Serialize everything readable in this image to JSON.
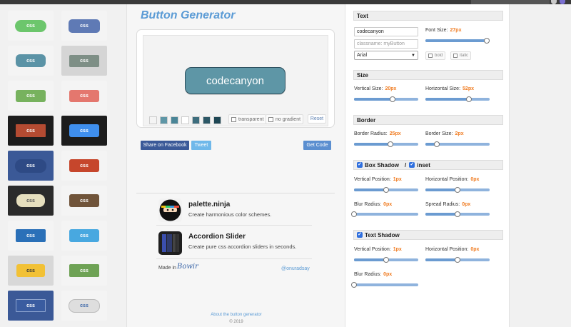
{
  "app": {
    "title": "Button Generator"
  },
  "preview": {
    "button_text": "codecanyon",
    "transparent_label": "transparent",
    "no_gradient_label": "no gradient",
    "reset_label": "Reset",
    "swatches": [
      "#f4f4f4",
      "#5e96a6",
      "#4a8597",
      "#ffffff",
      "#3d6d7d",
      "#2c5766",
      "#1e4654"
    ]
  },
  "actions": {
    "share_label": "Share on Facebook",
    "tweet_label": "Tweet",
    "get_code_label": "Get Code"
  },
  "promos": [
    {
      "title": "palette.ninja",
      "desc": "Create harmonious color schemes."
    },
    {
      "title": "Accordion Slider",
      "desc": "Create pure css accordion sliders in seconds."
    }
  ],
  "made_in": {
    "label": "Made in",
    "sig": "Bowir",
    "handle": "@onuradsay"
  },
  "footer": {
    "about": "About the button generator",
    "copyright": "© 2019"
  },
  "text_section": {
    "title": "Text",
    "text_value": "codecanyon",
    "classname_placeholder": "classname: myButton",
    "font_size_label": "Font Size:",
    "font_size_value": "27px",
    "font_size_level": 0.95,
    "font_family": "Arial",
    "bold_label": "bold",
    "italic_label": "italic"
  },
  "size_section": {
    "title": "Size",
    "vertical_label": "Vertical Size:",
    "vertical_value": "20px",
    "vertical_level": 0.6,
    "horizontal_label": "Horizontal Size:",
    "horizontal_value": "52px",
    "horizontal_level": 0.68
  },
  "border_section": {
    "title": "Border",
    "radius_label": "Border Radius:",
    "radius_value": "25px",
    "radius_level": 0.57,
    "size_label": "Border Size:",
    "size_value": "2px",
    "size_level": 0.18
  },
  "box_shadow_section": {
    "title": "Box Shadow",
    "separator": "/",
    "inset_label": "inset",
    "vpos_label": "Vertical Position:",
    "vpos_value": "1px",
    "vpos_level": 0.5,
    "hpos_label": "Horizontal Position:",
    "hpos_value": "0px",
    "hpos_level": 0.5,
    "blur_label": "Blur Radius:",
    "blur_value": "0px",
    "blur_level": 0.0,
    "spread_label": "Spread Radius:",
    "spread_value": "0px",
    "spread_level": 0.5
  },
  "text_shadow_section": {
    "title": "Text Shadow",
    "vpos_label": "Vertical Position:",
    "vpos_value": "1px",
    "vpos_level": 0.5,
    "hpos_label": "Horizontal Position:",
    "hpos_value": "0px",
    "hpos_level": 0.5,
    "blur_label": "Blur Radius:",
    "blur_value": "0px",
    "blur_level": 0.0
  },
  "presets": [
    {
      "label": "css",
      "bg": "#f4f4f4",
      "btn": "#6cc66c",
      "fg": "#ffffff"
    },
    {
      "label": "css",
      "bg": "#f4f4f4",
      "btn": "#5f7ab5",
      "fg": "#ffffff"
    },
    {
      "label": "css",
      "bg": "#f4f4f4",
      "btn": "#5b93a6",
      "fg": "#ffffff"
    },
    {
      "label": "css",
      "bg": "#d5d5d5",
      "btn": "#7e8f86",
      "fg": "#ffffff"
    },
    {
      "label": "css",
      "bg": "#f4f4f4",
      "btn": "#77b25e",
      "fg": "#ffffff"
    },
    {
      "label": "css",
      "bg": "#f4f4f4",
      "btn": "#e4776e",
      "fg": "#ffffff"
    },
    {
      "label": "css",
      "bg": "#1c1c1c",
      "btn": "#b44b32",
      "fg": "#ffffff"
    },
    {
      "label": "css",
      "bg": "#1c1c1c",
      "btn": "#3f8fee",
      "fg": "#ffffff"
    },
    {
      "label": "css",
      "bg": "#3b5997",
      "btn": "#2e4a85",
      "fg": "#ffffff"
    },
    {
      "label": "css",
      "bg": "#f4f4f4",
      "btn": "#c6462c",
      "fg": "#ffffff"
    },
    {
      "label": "css",
      "bg": "#2b2b2b",
      "btn": "#e6dfbe",
      "fg": "#555555"
    },
    {
      "label": "css",
      "bg": "#f4f4f4",
      "btn": "#70543a",
      "fg": "#ffffff"
    },
    {
      "label": "css",
      "bg": "#f4f4f4",
      "btn": "#2a70b8",
      "fg": "#ffffff"
    },
    {
      "label": "css",
      "bg": "#f4f4f4",
      "btn": "#48a8e0",
      "fg": "#ffffff"
    },
    {
      "label": "css",
      "bg": "#d8d8d8",
      "btn": "#f2c135",
      "fg": "#333333"
    },
    {
      "label": "css",
      "bg": "#f4f4f4",
      "btn": "#6ea255",
      "fg": "#ffffff"
    },
    {
      "label": "css",
      "bg": "#3b5997",
      "btn": "#3a5ca0",
      "fg": "#ffffff"
    },
    {
      "label": "css",
      "bg": "#f4f4f4",
      "btn": "#dedede",
      "fg": "#3b66a8"
    }
  ]
}
